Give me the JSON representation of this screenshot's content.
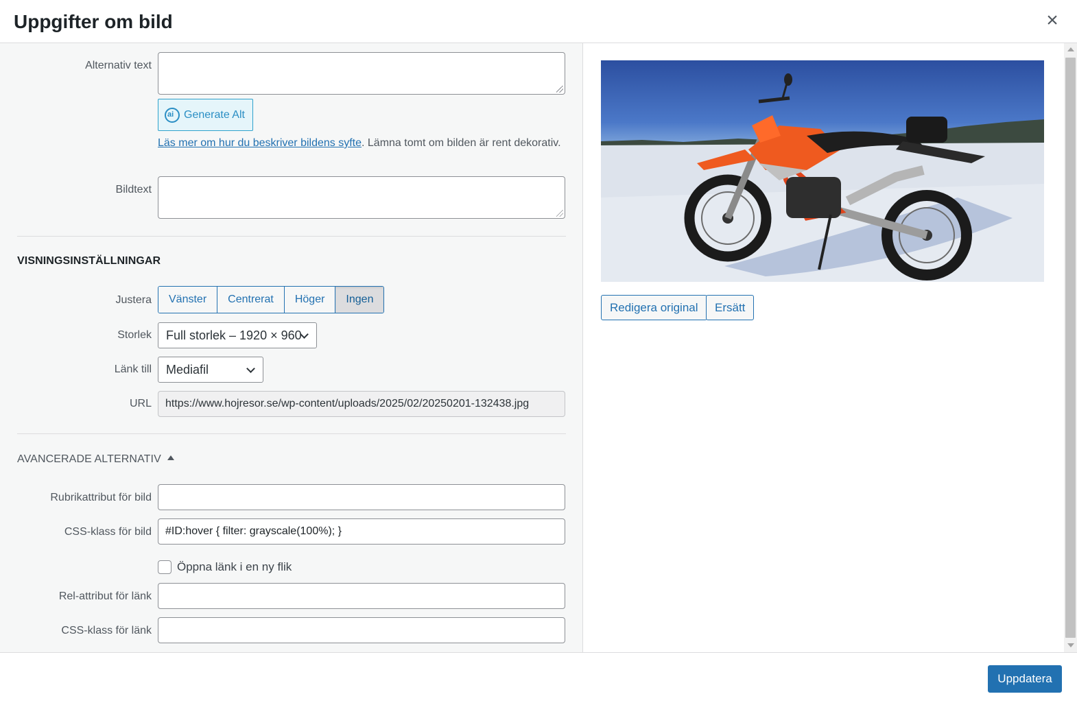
{
  "modal": {
    "title": "Uppgifter om bild",
    "close_icon": "close-icon"
  },
  "alt_text": {
    "label": "Alternativ text",
    "value": "",
    "generate_button": "Generate Alt",
    "help_link": "Läs mer om hur du beskriver bildens syfte",
    "help_suffix": ". Lämna tomt om bilden är rent dekorativ."
  },
  "caption": {
    "label": "Bildtext",
    "value": ""
  },
  "display_settings": {
    "heading": "Visningsinställningar",
    "align": {
      "label": "Justera",
      "options": [
        "Vänster",
        "Centrerat",
        "Höger",
        "Ingen"
      ],
      "selected": "Ingen"
    },
    "size": {
      "label": "Storlek",
      "selected": "Full storlek – 1920 × 960"
    },
    "link_to": {
      "label": "Länk till",
      "selected": "Mediafil"
    },
    "url": {
      "label": "URL",
      "value": "https://www.hojresor.se/wp-content/uploads/2025/02/20250201-132438.jpg"
    }
  },
  "advanced": {
    "heading": "Avancerade alternativ",
    "image_title": {
      "label": "Rubrikattribut för bild",
      "value": ""
    },
    "image_css": {
      "label": "CSS-klass för bild",
      "value": "#ID:hover { filter: grayscale(100%); }"
    },
    "new_tab": {
      "label": "Öppna länk i en ny flik",
      "checked": false
    },
    "link_rel": {
      "label": "Rel-attribut för länk",
      "value": ""
    },
    "link_css": {
      "label": "CSS-klass för länk",
      "value": ""
    }
  },
  "preview": {
    "edit_button": "Redigera original",
    "replace_button": "Ersätt"
  },
  "footer": {
    "update_button": "Uppdatera"
  },
  "colors": {
    "accent": "#2271b1",
    "pane_bg": "#f6f7f7",
    "ai_blue": "#2a8ec4"
  }
}
